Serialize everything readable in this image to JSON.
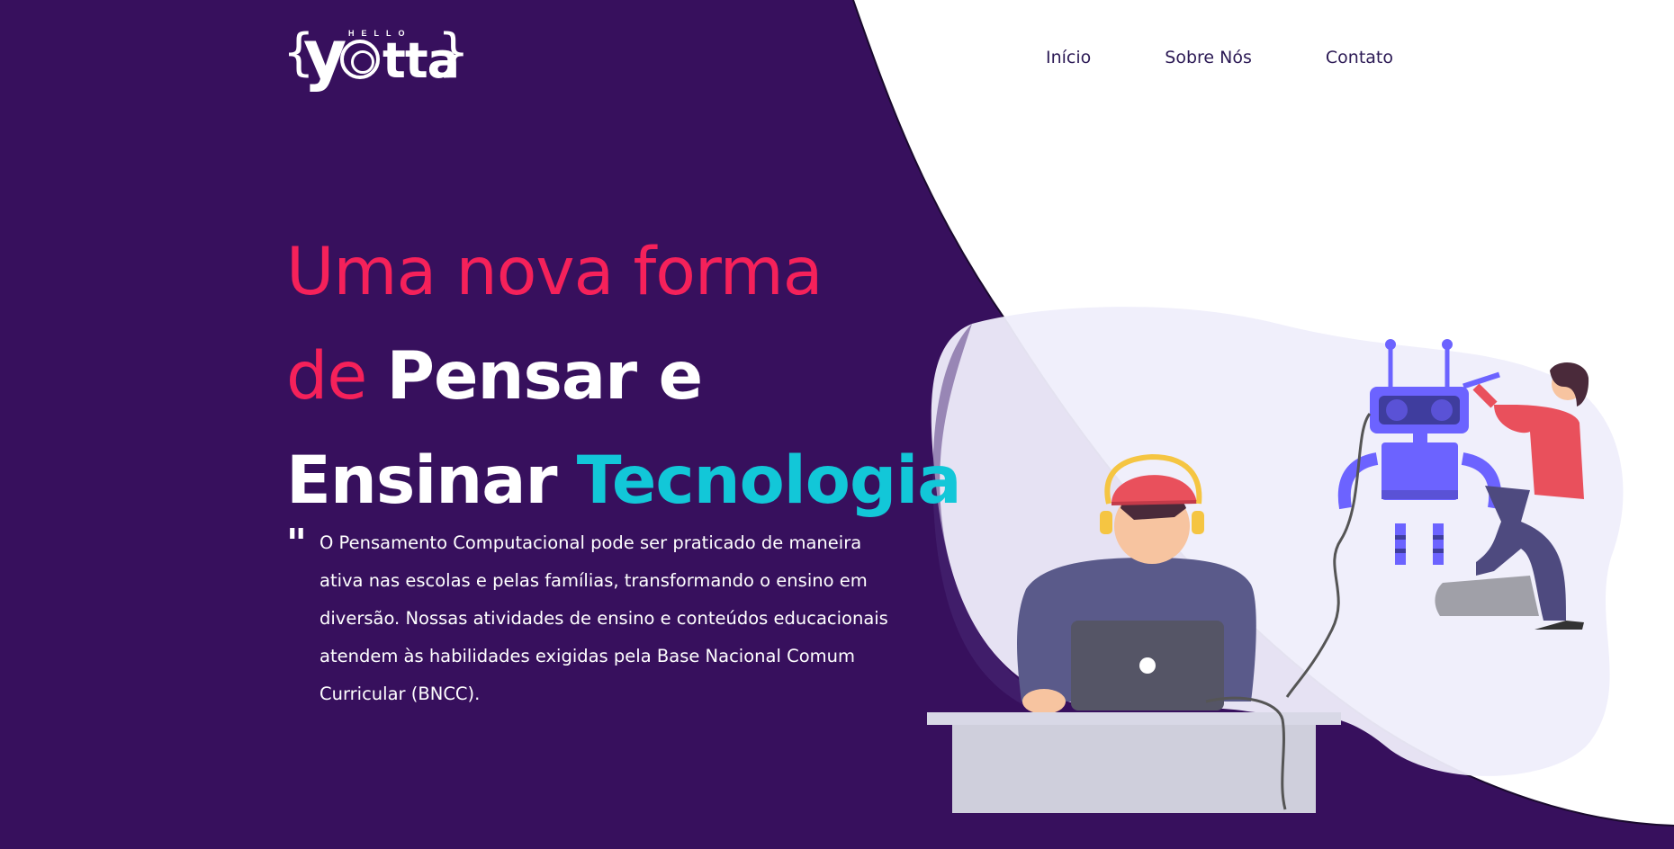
{
  "brand": {
    "logo_alt": "Hello Yotta",
    "brace_open": "{",
    "logo_y": "y",
    "logo_rest": "tta",
    "brace_close": "}",
    "logo_hello": "HELLO"
  },
  "nav": {
    "items": [
      {
        "label": "Início"
      },
      {
        "label": "Sobre Nós"
      },
      {
        "label": "Contato"
      }
    ]
  },
  "hero": {
    "line1": "Uma nova forma",
    "line2_part1": "de",
    "line2_part2": "Pensar e",
    "line3_part1": "Ensinar",
    "line3_part2": "Tecnologia",
    "quote_mark": "\"",
    "description": "O Pensamento Computacional pode ser praticado de maneira ativa nas escolas e pelas famílias, transformando o ensino em diversão. Nossas atividades de ensino e conteúdos educacionais atendem às habilidades exigidas pela Base Nacional Comum Curricular (BNCC)."
  },
  "colors": {
    "background": "#37105d",
    "accent_pink": "#f5215a",
    "accent_cyan": "#12c7d8",
    "white_area": "#ffffff",
    "nav_text": "#2c1a55",
    "robot": "#6c63ff",
    "person_shirt": "#e9505c"
  },
  "icons": [
    "logo-icon",
    "robot-illustration",
    "student-illustration"
  ]
}
